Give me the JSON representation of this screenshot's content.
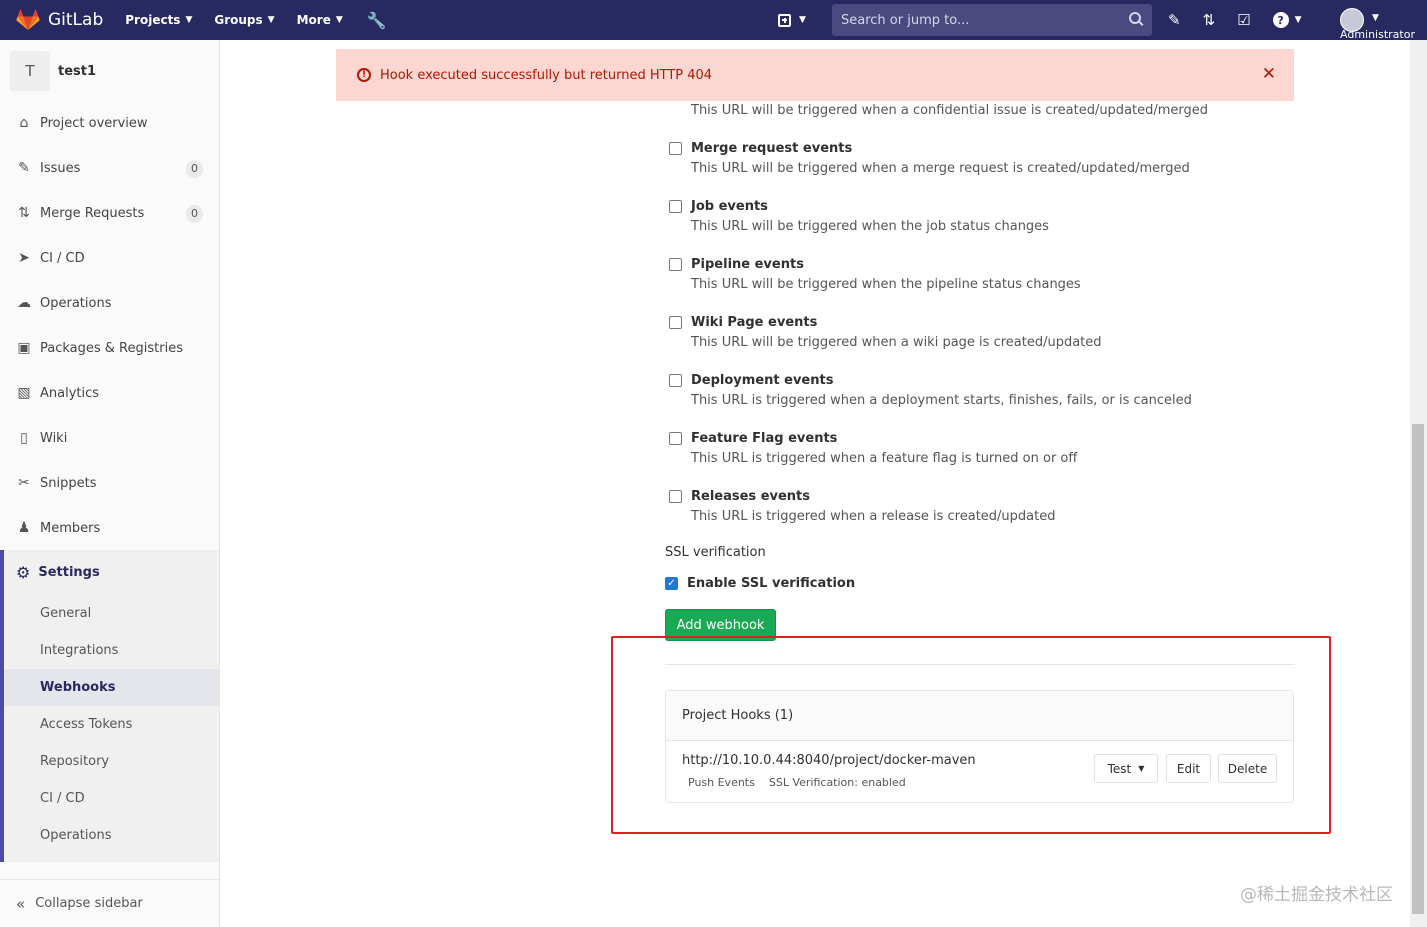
{
  "navbar": {
    "brand": "GitLab",
    "menus": [
      {
        "label": "Projects"
      },
      {
        "label": "Groups"
      },
      {
        "label": "More"
      }
    ],
    "search_placeholder": "Search or jump to...",
    "user_label": "Administrator"
  },
  "sidebar": {
    "project_initial": "T",
    "project_name": "test1",
    "items": [
      {
        "label": "Project overview",
        "icon": "home-icon"
      },
      {
        "label": "Issues",
        "icon": "issues-icon",
        "badge": "0"
      },
      {
        "label": "Merge Requests",
        "icon": "merge-request-icon",
        "badge": "0"
      },
      {
        "label": "CI / CD",
        "icon": "rocket-icon"
      },
      {
        "label": "Operations",
        "icon": "cloud-gear-icon"
      },
      {
        "label": "Packages & Registries",
        "icon": "package-icon"
      },
      {
        "label": "Analytics",
        "icon": "chart-icon"
      },
      {
        "label": "Wiki",
        "icon": "book-icon"
      },
      {
        "label": "Snippets",
        "icon": "scissors-icon"
      },
      {
        "label": "Members",
        "icon": "users-icon"
      }
    ],
    "settings_label": "Settings",
    "settings_items": [
      {
        "label": "General"
      },
      {
        "label": "Integrations"
      },
      {
        "label": "Webhooks",
        "active": true
      },
      {
        "label": "Access Tokens"
      },
      {
        "label": "Repository"
      },
      {
        "label": "CI / CD"
      },
      {
        "label": "Operations"
      }
    ],
    "collapse_label": "Collapse sidebar"
  },
  "flash": {
    "message": "Hook executed successfully but returned HTTP 404"
  },
  "events": {
    "confidential_issue_desc": "This URL will be triggered when a confidential issue is created/updated/merged",
    "items": [
      {
        "label": "Merge request events",
        "desc": "This URL will be triggered when a merge request is created/updated/merged",
        "checked": false
      },
      {
        "label": "Job events",
        "desc": "This URL will be triggered when the job status changes",
        "checked": false
      },
      {
        "label": "Pipeline events",
        "desc": "This URL will be triggered when the pipeline status changes",
        "checked": false
      },
      {
        "label": "Wiki Page events",
        "desc": "This URL will be triggered when a wiki page is created/updated",
        "checked": false
      },
      {
        "label": "Deployment events",
        "desc": "This URL is triggered when a deployment starts, finishes, fails, or is canceled",
        "checked": false
      },
      {
        "label": "Feature Flag events",
        "desc": "This URL is triggered when a feature flag is turned on or off",
        "checked": false
      },
      {
        "label": "Releases events",
        "desc": "This URL is triggered when a release is created/updated",
        "checked": false
      }
    ]
  },
  "ssl": {
    "title": "SSL verification",
    "checkbox_label": "Enable SSL verification",
    "checked": true
  },
  "add_button": "Add webhook",
  "hooks": {
    "title": "Project Hooks (1)",
    "url": "http://10.10.0.44:8040/project/docker-maven",
    "tags": [
      "Push Events",
      "SSL Verification: enabled"
    ],
    "test_label": "Test",
    "edit_label": "Edit",
    "delete_label": "Delete"
  },
  "watermark": "@稀土掘金技术社区",
  "colors": {
    "navbar": "#292961",
    "flash_bg": "#fcd7d2",
    "flash_text": "#ae1800",
    "success": "#1aaa55",
    "highlight_box": "#e02020"
  }
}
